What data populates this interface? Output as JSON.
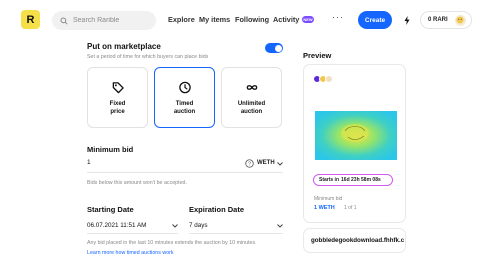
{
  "header": {
    "logo_letter": "R",
    "search_placeholder": "Search Rarible",
    "nav": [
      "Explore",
      "My items",
      "Following",
      "Activity"
    ],
    "new_badge": "NEW",
    "more": "···",
    "create_label": "Create",
    "wallet_amount": "0 RARI"
  },
  "colors": {
    "accent": "#1565ff",
    "logo": "#f6e04a",
    "timer_border": "#ce5cf0",
    "badge": "#7b4dff"
  },
  "form": {
    "title": "Put on marketplace",
    "subtitle": "Set a period of time for which buyers can place bids",
    "toggle_on": true,
    "cards": [
      {
        "label": "Fixed\nprice",
        "icon": "price-tag-icon",
        "selected": false
      },
      {
        "label": "Timed\nauction",
        "icon": "clock-icon",
        "selected": true
      },
      {
        "label": "Unlimited\nauction",
        "icon": "infinity-icon",
        "selected": false
      }
    ],
    "min_bid_label": "Minimum bid",
    "min_bid_value": "1",
    "currency": "WETH",
    "min_bid_note": "Bids below this amount won't be accepted.",
    "start_label": "Starting Date",
    "start_value": "06.07.2021 11:51 AM",
    "exp_label": "Expiration Date",
    "exp_value": "7 days",
    "auction_note": "Any bid placed in the last 10 minutes extends the auction by 10 minutes.",
    "learn_more": "Learn more how timed auctions work"
  },
  "preview": {
    "label": "Preview",
    "timer_prefix": "Starts in",
    "timer_value": "16d  23h  58m  08s",
    "min_bid_label": "Minimum bid",
    "min_bid_value": "1 WETH",
    "of": "1 of 1"
  },
  "file_name": "gobbledegookdownload.fhhfk.c"
}
